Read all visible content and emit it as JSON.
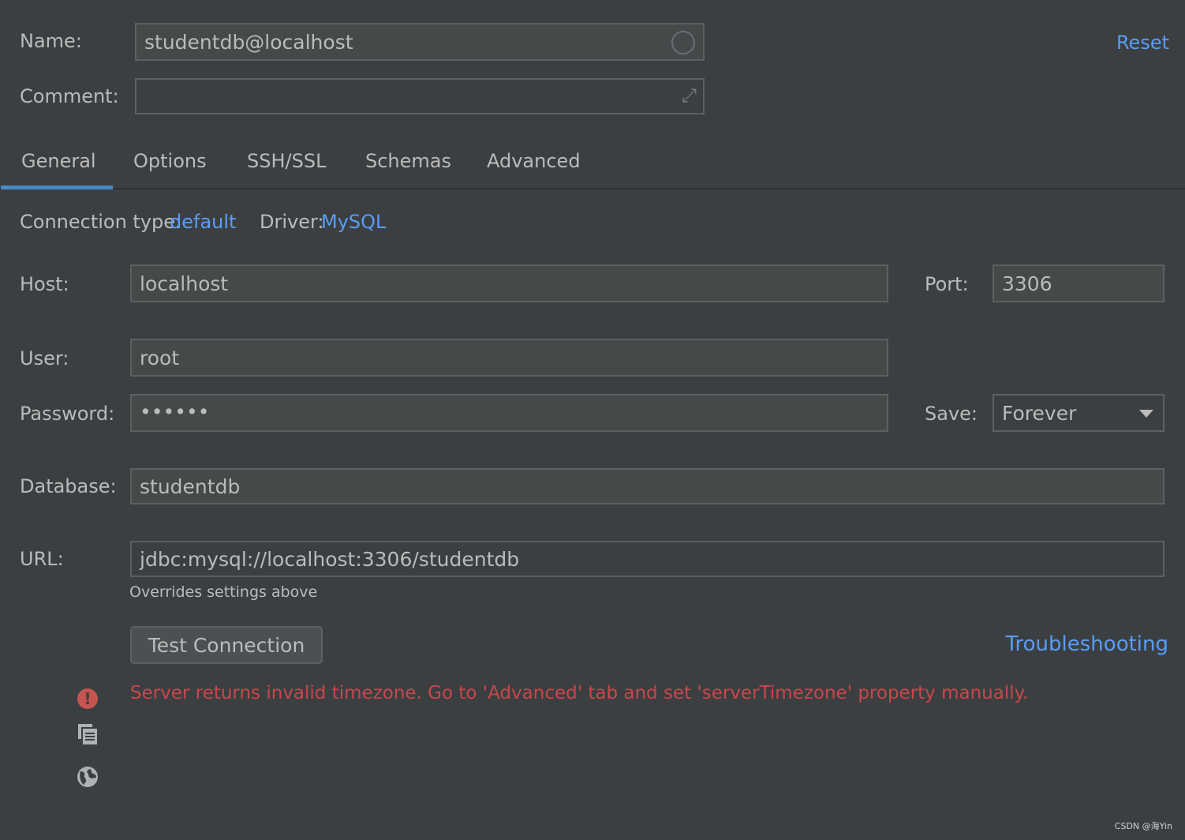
{
  "name": {
    "label": "Name:",
    "value": "studentdb@localhost"
  },
  "comment": {
    "label": "Comment:",
    "value": ""
  },
  "reset": "Reset",
  "tabs": [
    {
      "label": "General",
      "active": true
    },
    {
      "label": "Options"
    },
    {
      "label": "SSH/SSL"
    },
    {
      "label": "Schemas"
    },
    {
      "label": "Advanced"
    }
  ],
  "connection_type": {
    "label": "Connection type:",
    "value": "default"
  },
  "driver": {
    "label": "Driver:",
    "value": "MySQL"
  },
  "host": {
    "label": "Host:",
    "value": "localhost"
  },
  "port": {
    "label": "Port:",
    "value": "3306"
  },
  "user": {
    "label": "User:",
    "value": "root"
  },
  "password": {
    "label": "Password:",
    "value": "••••••"
  },
  "save": {
    "label": "Save:",
    "value": "Forever"
  },
  "database": {
    "label": "Database:",
    "value": "studentdb"
  },
  "url": {
    "label": "URL:",
    "value": "jdbc:mysql://localhost:3306/studentdb",
    "hint": "Overrides settings above"
  },
  "test_connection": "Test Connection",
  "troubleshooting": "Troubleshooting",
  "error": "Server returns invalid timezone. Go to 'Advanced' tab and set 'serverTimezone' property manually.",
  "watermark": "CSDN @海Yin",
  "colors": {
    "accent": "#589df6",
    "error": "#c7474c",
    "background": "#3c3f41",
    "tab_underline": "#4a88c7"
  }
}
